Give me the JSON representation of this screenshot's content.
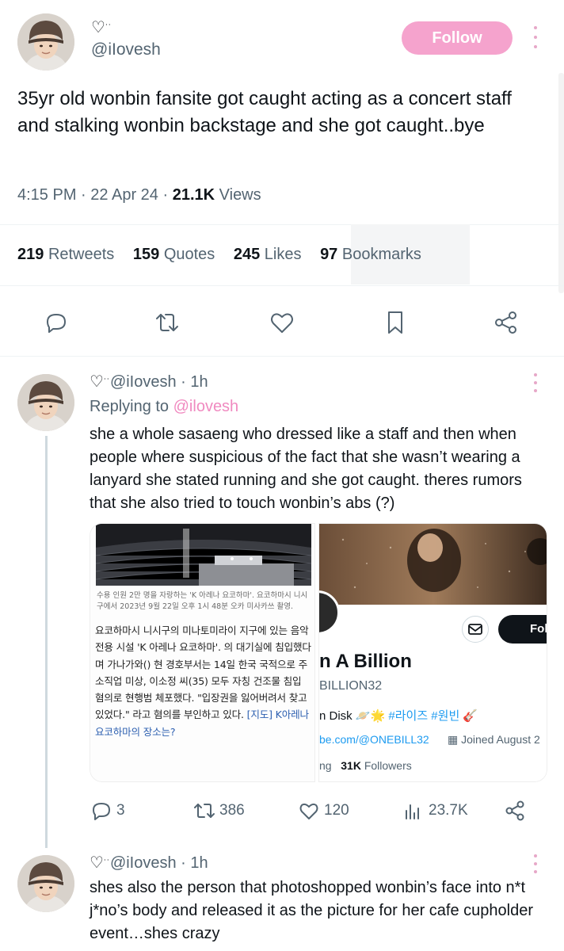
{
  "main_tweet": {
    "display_name": "♡",
    "name_dots": "˙˙",
    "handle": "@iIovesh",
    "follow_label": "Follow",
    "text": "35yr old wonbin fansite got caught acting as a concert staff and stalking wonbin backstage and she got caught..bye",
    "time": "4:15 PM",
    "date": "22 Apr 24",
    "views_count": "21.1K",
    "views_label": "Views",
    "stats": [
      {
        "count": "219",
        "label": "Retweets"
      },
      {
        "count": "159",
        "label": "Quotes"
      },
      {
        "count": "245",
        "label": "Likes"
      },
      {
        "count": "97",
        "label": "Bookmarks"
      }
    ],
    "actions": [
      "reply-icon",
      "retweet-icon",
      "like-icon",
      "bookmark-icon",
      "share-icon"
    ]
  },
  "reply1": {
    "heart": "♡",
    "dots": "˙˙",
    "handle": "@iIovesh",
    "age": "1h",
    "replying_prefix": "Replying to",
    "replying_handle": "@ilovesh",
    "text": "she a whole sasaeng who dressed like a staff and then when people where suspicious of the fact that she wasn’t wearing a lanyard she stated running and she got caught. theres rumors that she also tried to touch wonbin’s abs (?)",
    "media_left": {
      "caption": "수용 인원 2만 명을 자랑하는 'K 아레나 요코하마'. 요코하마시 니시구에서 2023년 9월 22일 오후 1시 48분 오카 미사카쓰 촬영.",
      "article_main": "요코하마시 니시구의 미나토미라이 지구에 있는 음악 전용 시설 'K 아레나 요코하마'. 의 대기실에 침입했다며 가나가와() 현 경호부서는 14일 한국 국적으로 주소직업 미상, 이소정 씨(35) 모두 자칭 건조물 침입 혐의로 현행범 체포했다. \"입장권을 잃어버려서 찾고 있었다.\" 라고 혐의를 부인하고 있다.",
      "article_link": "[지도] K아레나 요코하마의 장소는?"
    },
    "media_right": {
      "follow_label": "Fol",
      "name": "n A Billion",
      "handle": "BILLION32",
      "bio_text": "n Disk",
      "bio_emojis": "🪐🌟",
      "bio_tags": "#라이즈 #원빈",
      "bio_end": "🎸",
      "link": "be.com/@ONEBILL32",
      "joined": "Joined August 2",
      "following_frag": "ng",
      "followers_count": "31K",
      "followers_label": "Followers"
    },
    "actions": {
      "replies": "3",
      "retweets": "386",
      "likes": "120",
      "views": "23.7K"
    }
  },
  "reply2": {
    "heart": "♡",
    "dots": "˙˙",
    "handle": "@iIovesh",
    "age": "1h",
    "text": "shes also the person that photoshopped wonbin’s face into n*t j*no’s body and released it as the picture for her cafe cupholder event…shes crazy"
  },
  "colors": {
    "accent_pink": "#f5a3cd",
    "link_pink": "#f08ac0",
    "text": "#0f1419",
    "muted": "#536471"
  }
}
